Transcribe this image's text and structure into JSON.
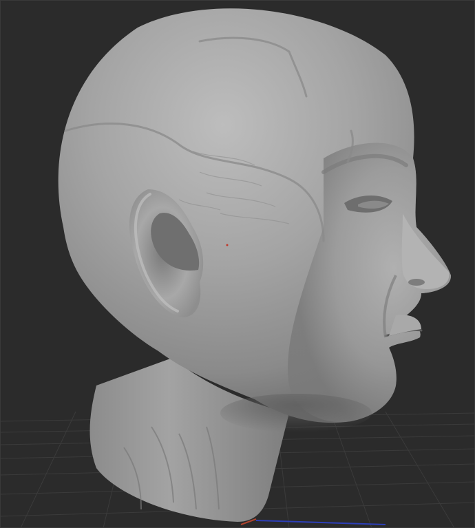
{
  "viewport": {
    "background_color": "#2b2b2b",
    "grid_color": "#3a3a3a",
    "axis_x_color": "#b0442e",
    "axis_z_color": "#2d3fb8",
    "model": {
      "subject": "sculpted-human-head",
      "material_color": "#9a9a9a",
      "shading": "matcap-gray"
    }
  }
}
